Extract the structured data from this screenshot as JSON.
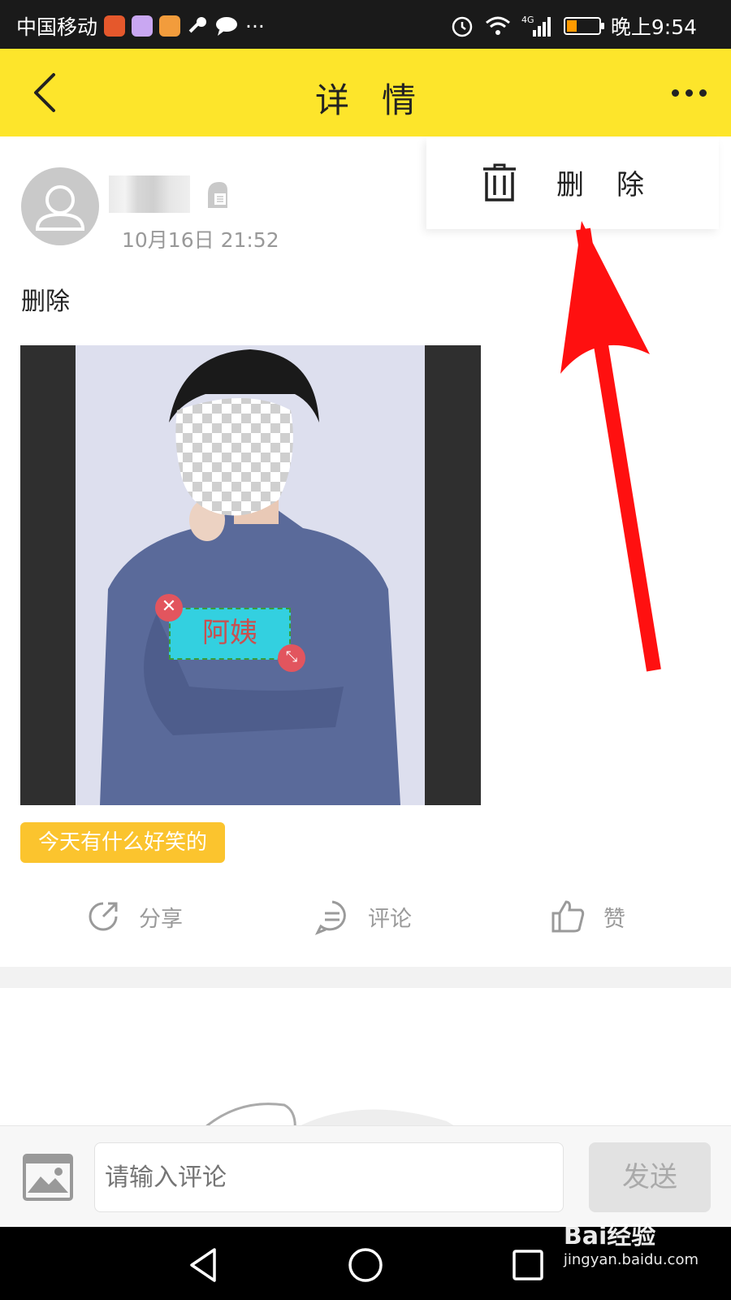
{
  "status_bar": {
    "carrier": "中国移动",
    "time": "晚上9:54",
    "network": "4G",
    "more": "···"
  },
  "header": {
    "title": "详情"
  },
  "popup_menu": {
    "delete_label": "删除"
  },
  "post": {
    "timestamp": "10月16日 21:52",
    "text": "删除",
    "sticker_text": "阿姨",
    "topic_tag": "今天有什么好笑的"
  },
  "actions": {
    "share": "分享",
    "comment": "评论",
    "like": "赞"
  },
  "comment_bar": {
    "placeholder": "请输入评论",
    "send": "发送"
  },
  "watermark": {
    "brand": "Bai经验",
    "url": "jingyan.baidu.com"
  },
  "colors": {
    "header_bg": "#fde52b",
    "tag_bg": "#fbc42e",
    "annotation_arrow": "#ff0000"
  }
}
